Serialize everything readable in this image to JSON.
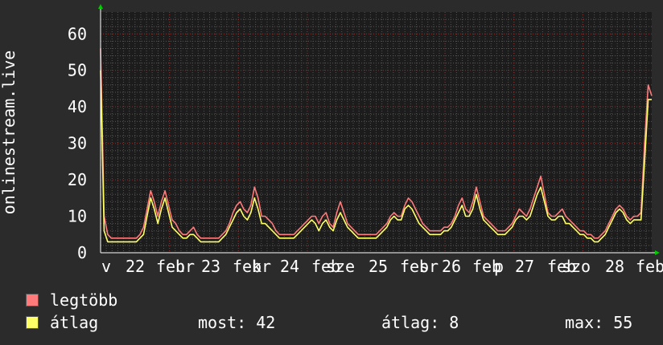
{
  "chart_data": {
    "type": "line",
    "ylabel": "onlinestream.live",
    "ylim": [
      0,
      66
    ],
    "yticks": [
      0,
      10,
      20,
      30,
      40,
      50,
      60
    ],
    "x_tick_labels": [
      "v",
      "22",
      "feb",
      "hr",
      "23",
      "feb",
      "kr",
      "24",
      "feb",
      "sze",
      "25",
      "feb",
      "sr",
      "26",
      "feb",
      "p",
      "27",
      "feb",
      "szo",
      "28",
      "feb"
    ],
    "colors": {
      "legtobb": "#ff7a7a",
      "atlag": "#ffff66",
      "background": "#2b2b2b",
      "plot_bg": "#1c1c1c",
      "grid_major": "#8b2e2e",
      "grid_minor": "#555555",
      "axis_arrow": "#00cc00"
    },
    "grid": true,
    "series": [
      {
        "name": "legtöbb",
        "values": [
          56,
          10,
          5,
          4,
          4,
          4,
          4,
          4,
          4,
          4,
          4,
          5,
          7,
          12,
          17,
          14,
          10,
          14,
          17,
          13,
          9,
          8,
          6,
          5,
          5,
          6,
          7,
          5,
          4,
          4,
          4,
          4,
          4,
          4,
          5,
          6,
          8,
          11,
          13,
          14,
          12,
          11,
          13,
          18,
          15,
          10,
          10,
          9,
          8,
          6,
          5,
          5,
          5,
          5,
          5,
          6,
          7,
          8,
          9,
          10,
          10,
          8,
          10,
          11,
          8,
          7,
          11,
          14,
          11,
          8,
          7,
          6,
          5,
          5,
          5,
          5,
          5,
          5,
          6,
          7,
          8,
          10,
          11,
          10,
          10,
          13,
          15,
          14,
          12,
          10,
          8,
          7,
          6,
          6,
          6,
          6,
          7,
          7,
          8,
          10,
          13,
          15,
          12,
          11,
          14,
          18,
          14,
          10,
          9,
          8,
          7,
          6,
          6,
          6,
          7,
          8,
          10,
          12,
          11,
          10,
          12,
          15,
          18,
          21,
          16,
          11,
          10,
          10,
          11,
          12,
          10,
          9,
          8,
          7,
          6,
          6,
          5,
          5,
          4,
          4,
          5,
          6,
          8,
          10,
          12,
          13,
          12,
          10,
          9,
          10,
          10,
          11,
          30,
          46,
          43
        ],
        "display": "legtöbb"
      },
      {
        "name": "átlag",
        "values": [
          50,
          6,
          3,
          3,
          3,
          3,
          3,
          3,
          3,
          3,
          3,
          4,
          5,
          10,
          15,
          12,
          8,
          12,
          15,
          11,
          7,
          6,
          5,
          4,
          4,
          5,
          5,
          4,
          3,
          3,
          3,
          3,
          3,
          3,
          4,
          5,
          7,
          9,
          11,
          12,
          10,
          9,
          11,
          15,
          12,
          8,
          8,
          7,
          6,
          5,
          4,
          4,
          4,
          4,
          4,
          5,
          6,
          7,
          8,
          9,
          8,
          6,
          8,
          9,
          7,
          6,
          9,
          11,
          9,
          7,
          6,
          5,
          4,
          4,
          4,
          4,
          4,
          4,
          5,
          6,
          7,
          9,
          10,
          9,
          9,
          12,
          13,
          12,
          10,
          8,
          7,
          6,
          5,
          5,
          5,
          5,
          6,
          6,
          7,
          9,
          11,
          13,
          10,
          10,
          12,
          16,
          12,
          9,
          8,
          7,
          6,
          5,
          5,
          5,
          6,
          7,
          9,
          10,
          10,
          9,
          10,
          13,
          16,
          18,
          14,
          10,
          9,
          9,
          10,
          10,
          8,
          8,
          7,
          6,
          5,
          5,
          4,
          4,
          3,
          3,
          4,
          5,
          7,
          9,
          11,
          12,
          11,
          9,
          8,
          9,
          9,
          9,
          25,
          42,
          42
        ],
        "display": "átlag"
      }
    ]
  },
  "legend": {
    "items": [
      {
        "label": "legtöbb",
        "color": "#ff7a7a"
      },
      {
        "label": "átlag",
        "color": "#ffff66"
      }
    ]
  },
  "stats": {
    "now": "most: 42",
    "avg": "átlag: 8",
    "max": "max: 55"
  }
}
